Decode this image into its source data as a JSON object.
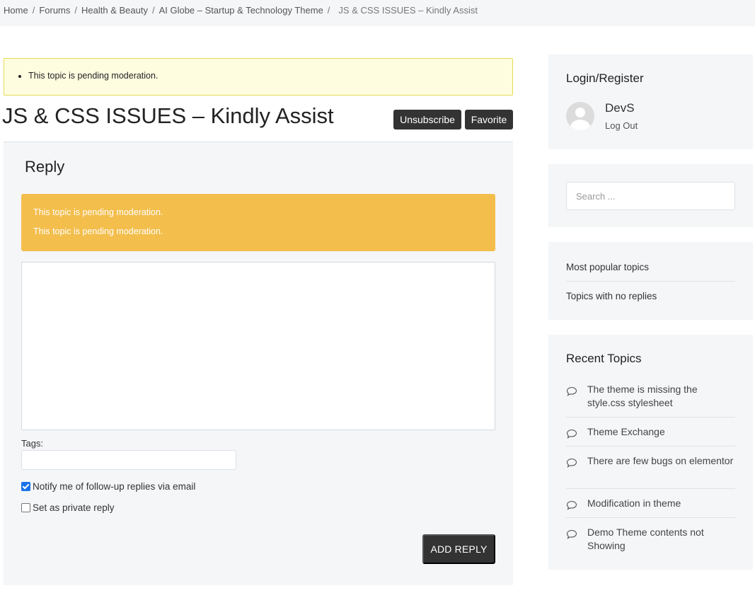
{
  "breadcrumb": {
    "items": [
      "Home",
      "Forums",
      "Health & Beauty",
      "AI Globe – Startup & Technology Theme"
    ],
    "current": "JS & CSS ISSUES – Kindly Assist",
    "separator": "/"
  },
  "notice": {
    "message": "This topic is pending moderation."
  },
  "topic": {
    "title": "JS & CSS ISSUES – Kindly Assist",
    "unsubscribe_label": "Unsubscribe",
    "favorite_label": "Favorite"
  },
  "reply": {
    "title": "Reply",
    "warnings": [
      "This topic is pending moderation.",
      "This topic is pending moderation."
    ],
    "textarea_value": "",
    "tags_label": "Tags:",
    "tags_value": "",
    "notify_label": "Notify me of follow-up replies via email",
    "notify_checked": true,
    "private_label": "Set as private reply",
    "private_checked": false,
    "submit_label": "ADD REPLY"
  },
  "sidebar": {
    "login": {
      "title": "Login/Register",
      "username": "DevS",
      "logout_label": "Log Out"
    },
    "search": {
      "placeholder": "Search ..."
    },
    "links": [
      "Most popular topics",
      "Topics with no replies"
    ],
    "recent": {
      "title": "Recent Topics",
      "items": [
        "The theme is missing the style.css stylesheet",
        "Theme Exchange",
        "There are few bugs on elementor",
        "Modification in theme",
        "Demo Theme contents not Showing"
      ]
    }
  },
  "colors": {
    "panel_bg": "#f4f6f8",
    "dark_button": "#333333",
    "warning_bg": "#f3be4c",
    "notice_bg": "#fffde0",
    "notice_border": "#e6db55",
    "checkbox_accent": "#1a73e8"
  }
}
